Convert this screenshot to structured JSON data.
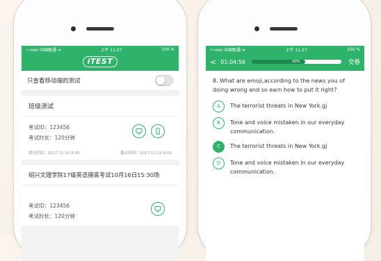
{
  "left": {
    "status": {
      "carrier": "••ooo 中国联通 ᯤ",
      "time": "上午 11:27",
      "battery": "100 %"
    },
    "logo": "iTEST",
    "mobile_toggle_label": "只查看移动端的测试",
    "mobile_toggle_on": false,
    "cards": [
      {
        "title": "班级测试",
        "exam_id": "考试ID：123456",
        "duration": "考试时长：120分钟",
        "submit_time": "提交时间：2017-11-20 8:00",
        "deadline": "截止时间：2017-11-20 8:00",
        "icons": [
          "monitor-icon",
          "phone-icon"
        ]
      },
      {
        "title": "绍兴文理学院17级英语摸底考试10月16日15:30场",
        "exam_id": "考试ID：123456",
        "duration": "考试时长：120分钟",
        "icons": [
          "monitor-icon"
        ]
      }
    ]
  },
  "right": {
    "status": {
      "carrier": "••ooo 中国联通 ᯤ",
      "time": "上午 11:27",
      "battery": "100 %"
    },
    "back_symbol": "<",
    "timer": "01:04:56",
    "progress_percent": 60,
    "progress_label": "60%",
    "submit_label": "交卷",
    "question": "8. What are emoji,according to the news you of doing wrong and so earn how to put it right?",
    "options": [
      {
        "letter": "A",
        "text": "The terrorist threats in New York.gj",
        "selected": false
      },
      {
        "letter": "B",
        "text": "Tone and voice mistaken in our everyday communication.",
        "selected": false
      },
      {
        "letter": "C",
        "text": "The terrorist threats in New York.gj",
        "selected": true
      },
      {
        "letter": "D",
        "text": "Tone and voice mistaken in our everyday communication.",
        "selected": false
      }
    ]
  },
  "colors": {
    "accent": "#2fb36b",
    "accent_dark": "#1e8a50"
  }
}
